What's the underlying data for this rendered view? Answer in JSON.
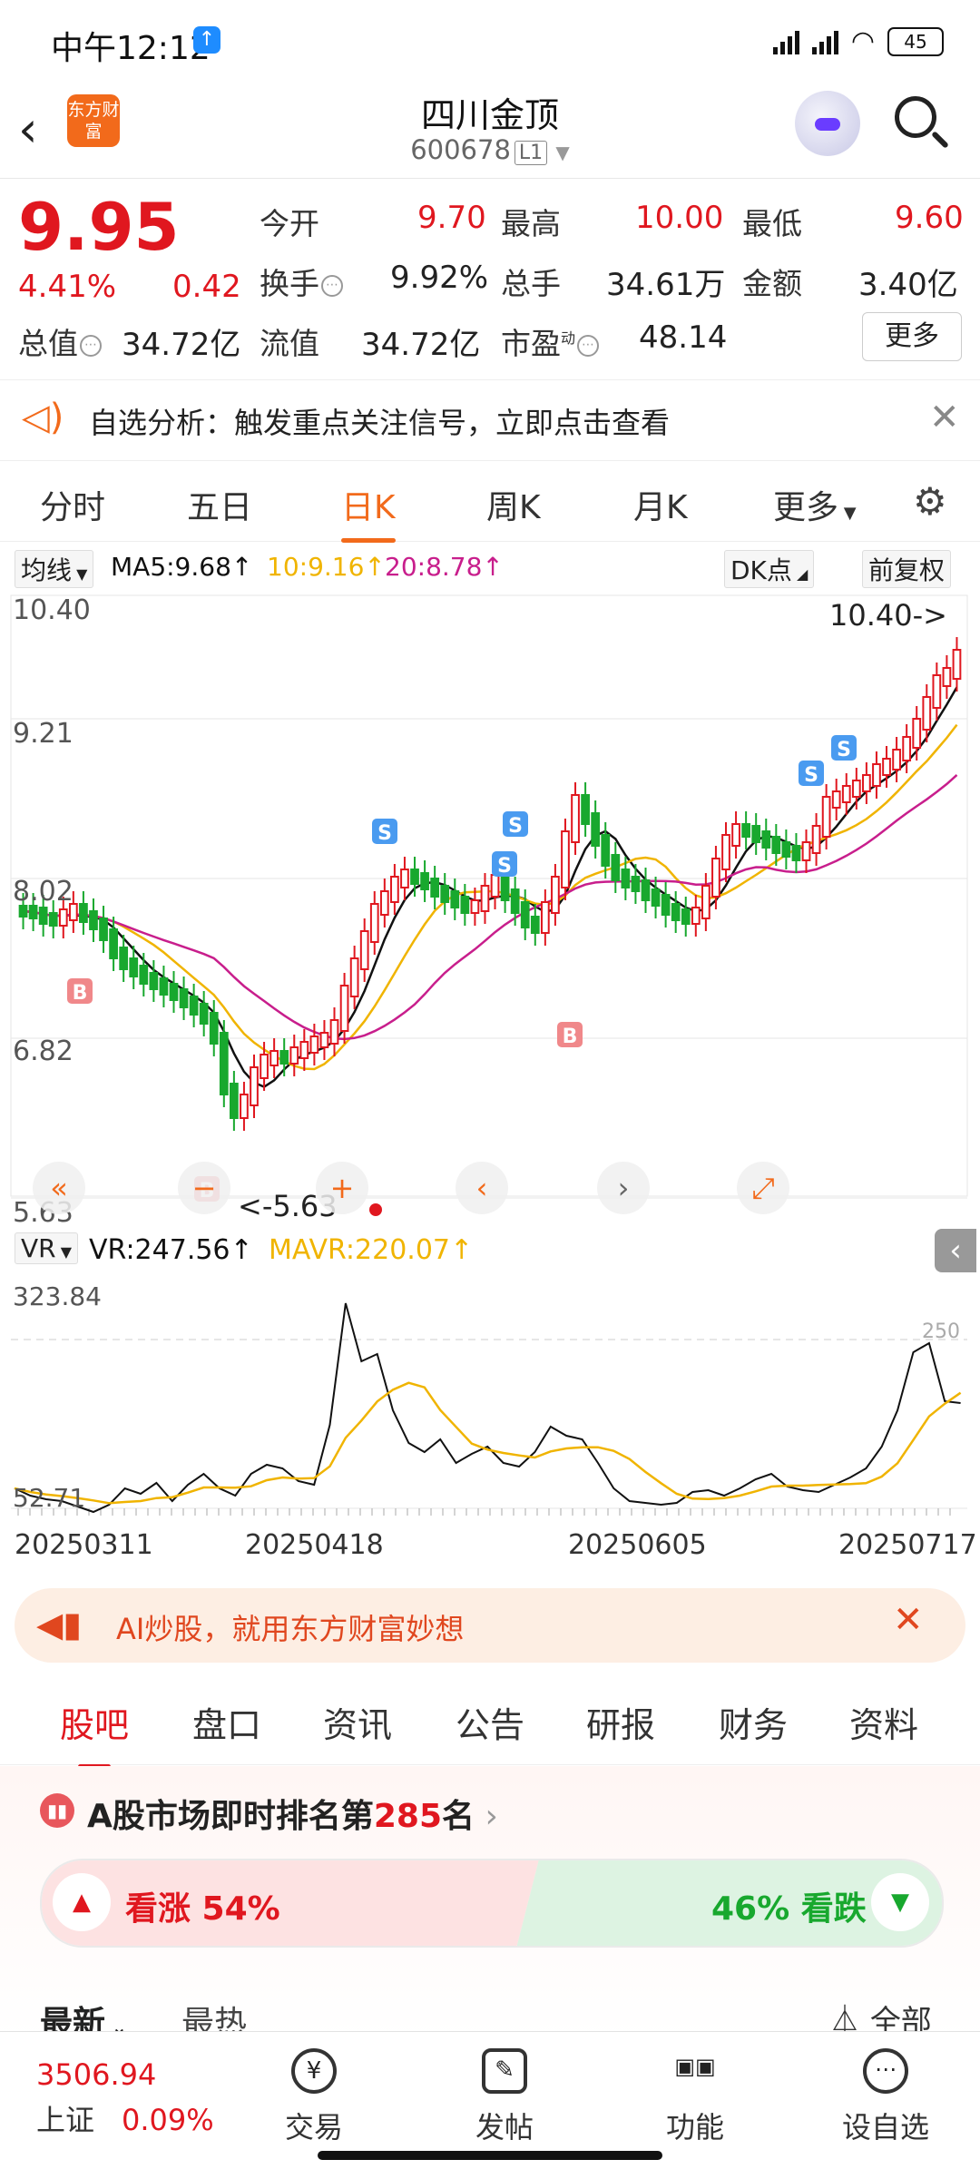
{
  "status": {
    "time": "中午12:12",
    "battery": "45"
  },
  "header": {
    "stock_name": "四川金顶",
    "stock_code": "600678",
    "level": "L1",
    "logo_text": "东方财富"
  },
  "quote": {
    "price": "9.95",
    "change_pct": "4.41%",
    "change": "0.42",
    "open_label": "今开",
    "open": "9.70",
    "high_label": "最高",
    "high": "10.00",
    "low_label": "最低",
    "low": "9.60",
    "turnover_label": "换手",
    "turnover": "9.92%",
    "volume_label": "总手",
    "volume": "34.61万",
    "amount_label": "金额",
    "amount": "3.40亿",
    "mktcap_label": "总值",
    "mktcap": "34.72亿",
    "float_label": "流值",
    "float_cap": "34.72亿",
    "pe_label": "市盈",
    "pe_sup": "动",
    "pe": "48.14",
    "more_label": "更多"
  },
  "banner": {
    "text": "自选分析：触发重点关注信号，立即点击查看"
  },
  "period_tabs": [
    "分时",
    "五日",
    "日K",
    "周K",
    "月K",
    "更多"
  ],
  "active_period": "日K",
  "legend": {
    "ma_select": "均线",
    "ma5": "MA5:9.68↑",
    "ma10": "10:9.16↑",
    "ma20": "20:8.78↑",
    "dk": "DK点",
    "adjust": "前复权"
  },
  "colors": {
    "up": "#e0171f",
    "down": "#18a82e",
    "ma5": "#111111",
    "ma10": "#f0b400",
    "ma20": "#c81e8c",
    "accent": "#f26a1b"
  },
  "chart_data": {
    "type": "candlestick",
    "y_ticks": [
      "10.40",
      "9.21",
      "8.02",
      "6.82",
      "5.63"
    ],
    "high_label": "10.40->",
    "low_label": "<-5.63",
    "x_ticks": [
      "20250311",
      "20250418",
      "20250605",
      "20250717"
    ],
    "signals": [
      "B",
      "B",
      "S",
      "S",
      "S",
      "B",
      "S",
      "S"
    ],
    "indicator": {
      "name": "VR",
      "vr": "VR:247.56↑",
      "mavr": "MAVR:220.07↑",
      "y_ticks": [
        "323.84",
        "52.71"
      ],
      "right_label": "250"
    }
  },
  "ai_banner": {
    "text": "AI炒股，就用东方财富妙想"
  },
  "news_tabs": [
    "股吧",
    "盘口",
    "资讯",
    "公告",
    "研报",
    "财务",
    "资料"
  ],
  "active_news_tab": "股吧",
  "rank": {
    "prefix": "A股市场即时排名第",
    "rank": "285",
    "suffix": "名"
  },
  "vote": {
    "up_label": "看涨 54%",
    "down_label": "46% 看跌",
    "up_pct": 54
  },
  "feed": {
    "latest": "最新",
    "hot": "最热",
    "all": "全部"
  },
  "bottom_nav": {
    "index_value": "3506.94",
    "index_name": "上证",
    "index_change": "0.09%",
    "items": [
      "交易",
      "发帖",
      "功能",
      "设自选"
    ]
  }
}
